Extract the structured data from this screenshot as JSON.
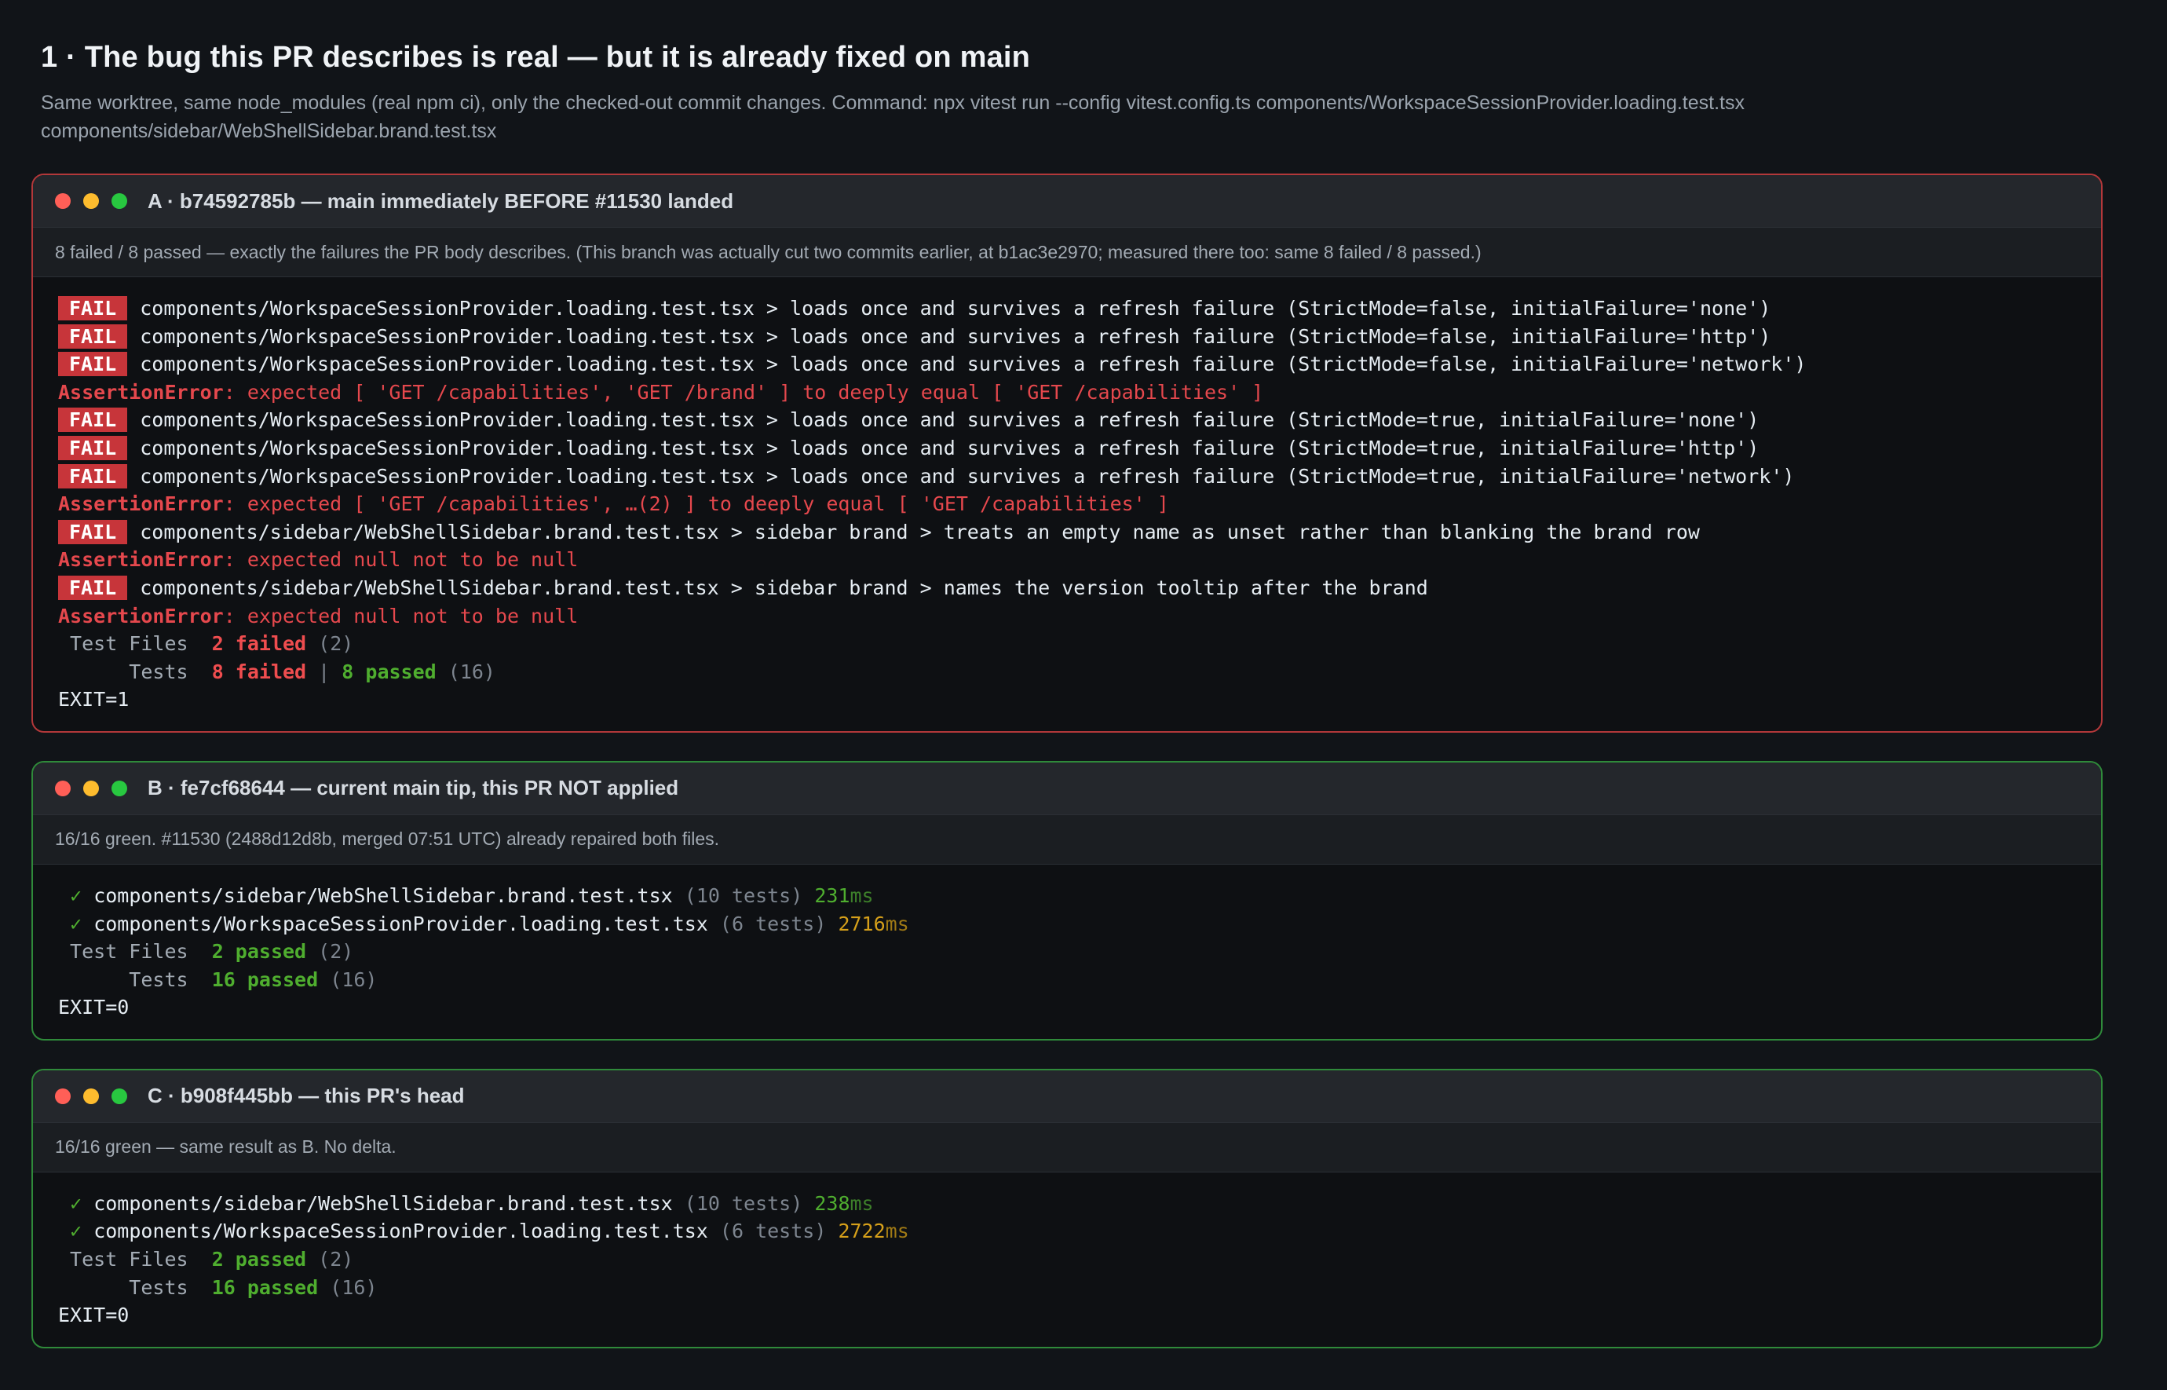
{
  "heading": "1 · The bug this PR describes is real — but it is already fixed on main",
  "intro": "Same worktree, same node_modules (real npm ci), only the checked-out commit changes. Command: npx vitest run --config vitest.config.ts components/WorkspaceSessionProvider.loading.test.tsx components/sidebar/WebShellSidebar.brand.test.tsx",
  "colors": {
    "fail_red": "#c7353a",
    "pass_green": "#4fae2f",
    "slow_yellow": "#d6a01a",
    "panel_red_border": "#b3383a",
    "panel_green_border": "#2f8a3a"
  },
  "panels": [
    {
      "title": "A · b74592785b — main immediately BEFORE #11530 landed",
      "note": "8 failed / 8 passed — exactly the failures the PR body describes. (This branch was actually cut two commits earlier, at b1ac3e2970; measured there too: same 8 failed / 8 passed.)",
      "fail_badge": "FAIL",
      "error_label": "AssertionError",
      "fails": [
        "components/WorkspaceSessionProvider.loading.test.tsx > loads once and survives a refresh failure (StrictMode=false, initialFailure='none')",
        "components/WorkspaceSessionProvider.loading.test.tsx > loads once and survives a refresh failure (StrictMode=false, initialFailure='http')",
        "components/WorkspaceSessionProvider.loading.test.tsx > loads once and survives a refresh failure (StrictMode=false, initialFailure='network')",
        "components/WorkspaceSessionProvider.loading.test.tsx > loads once and survives a refresh failure (StrictMode=true, initialFailure='none')",
        "components/WorkspaceSessionProvider.loading.test.tsx > loads once and survives a refresh failure (StrictMode=true, initialFailure='http')",
        "components/WorkspaceSessionProvider.loading.test.tsx > loads once and survives a refresh failure (StrictMode=true, initialFailure='network')",
        "components/sidebar/WebShellSidebar.brand.test.tsx > sidebar brand > treats an empty name as unset rather than blanking the brand row",
        "components/sidebar/WebShellSidebar.brand.test.tsx > sidebar brand > names the version tooltip after the brand"
      ],
      "errors": [
        ": expected [ 'GET /capabilities', 'GET /brand' ] to deeply equal [ 'GET /capabilities' ]",
        ": expected [ 'GET /capabilities', …(2) ] to deeply equal [ 'GET /capabilities' ]",
        ": expected null not to be null",
        ": expected null not to be null"
      ],
      "summary": {
        "files_label": " Test Files",
        "files_failed": "2 failed",
        "files_total": "(2)",
        "tests_label": "      Tests",
        "tests_failed": "8 failed",
        "sep": "|",
        "tests_passed": "8 passed",
        "tests_total": "(16)"
      },
      "exit": "EXIT=1"
    },
    {
      "title": "B · fe7cf68644 — current main tip, this PR NOT applied",
      "note": "16/16 green. #11530 (2488d12d8b, merged 07:51 UTC) already repaired both files.",
      "rows": [
        {
          "check": "✓",
          "file": "components/sidebar/WebShellSidebar.brand.test.tsx",
          "count": "(10 tests)",
          "ms": "231",
          "unit": "ms"
        },
        {
          "check": "✓",
          "file": "components/WorkspaceSessionProvider.loading.test.tsx",
          "count": "(6 tests)",
          "ms": "2716",
          "unit": "ms"
        }
      ],
      "summary": {
        "files_label": " Test Files",
        "files_passed": "2 passed",
        "files_total": "(2)",
        "tests_label": "      Tests",
        "tests_passed": "16 passed",
        "tests_total": "(16)"
      },
      "exit": "EXIT=0"
    },
    {
      "title": "C · b908f445bb — this PR's head",
      "note": "16/16 green — same result as B. No delta.",
      "rows": [
        {
          "check": "✓",
          "file": "components/sidebar/WebShellSidebar.brand.test.tsx",
          "count": "(10 tests)",
          "ms": "238",
          "unit": "ms"
        },
        {
          "check": "✓",
          "file": "components/WorkspaceSessionProvider.loading.test.tsx",
          "count": "(6 tests)",
          "ms": "2722",
          "unit": "ms"
        }
      ],
      "summary": {
        "files_label": " Test Files",
        "files_passed": "2 passed",
        "files_total": "(2)",
        "tests_label": "      Tests",
        "tests_passed": "16 passed",
        "tests_total": "(16)"
      },
      "exit": "EXIT=0"
    }
  ]
}
